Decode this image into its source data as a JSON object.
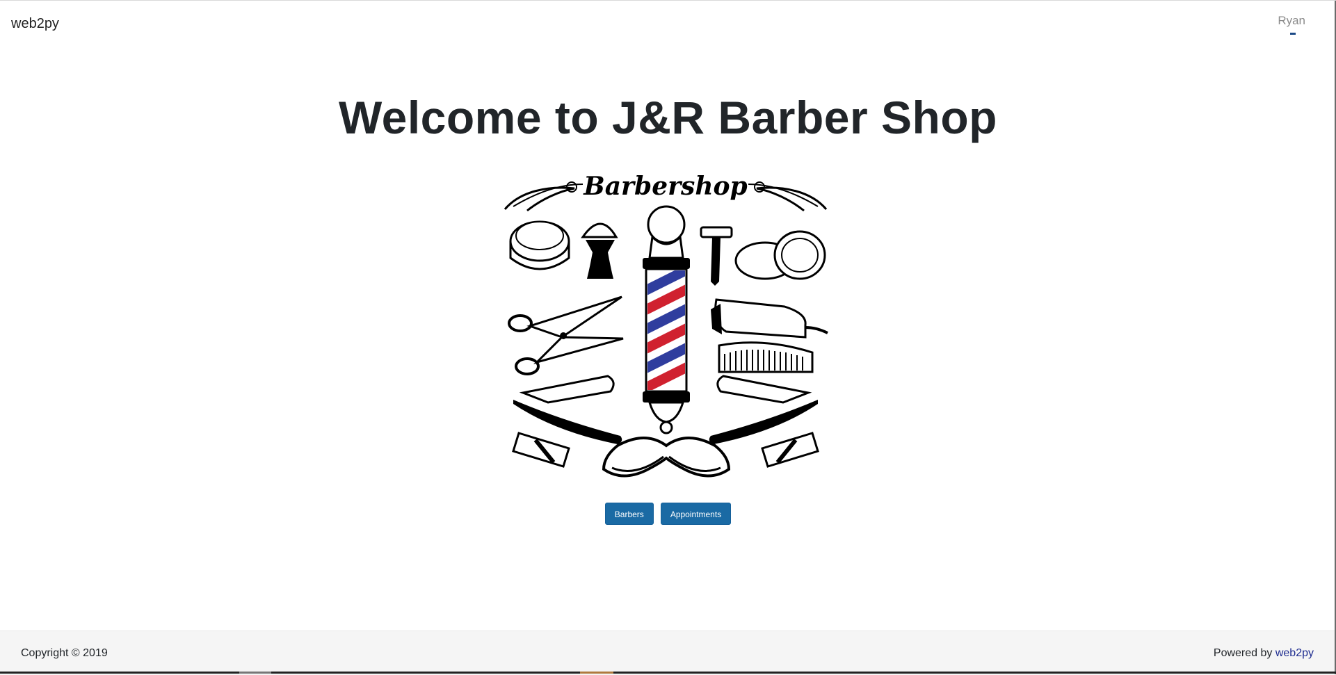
{
  "navbar": {
    "brand": "web2py",
    "user": "Ryan"
  },
  "main": {
    "title": "Welcome to J&R Barber Shop",
    "logo_text": "Barbershop",
    "buttons": [
      {
        "label": "Barbers"
      },
      {
        "label": "Appointments"
      }
    ]
  },
  "footer": {
    "copyright": "Copyright © 2019",
    "powered_prefix": "Powered by",
    "powered_link": "web2py"
  },
  "colors": {
    "button_bg": "#1a6aa4",
    "pole_red": "#d0212f",
    "pole_blue": "#2f3d9e",
    "footer_bg": "#f5f5f5"
  }
}
